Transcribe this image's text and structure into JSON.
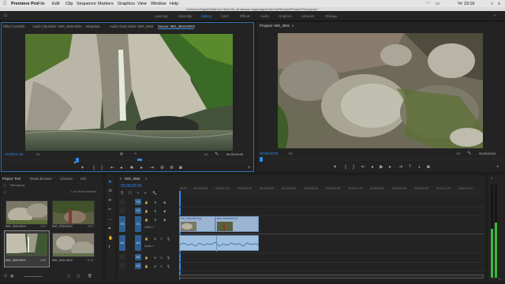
{
  "menubar": {
    "apple": "",
    "items": [
      "Premiere Pro",
      "File",
      "Edit",
      "Clip",
      "Sequence",
      "Markers",
      "Graphics",
      "View",
      "Window",
      "Help"
    ],
    "status": "Чт 19:16"
  },
  "window_title": "/Volumes/Imgal/DataCore 5min/00_Атласные водопады/Camera/Resolve/Project/Test.prproj *",
  "workspaces": {
    "home_icon": "home-icon",
    "items": [
      "Learning",
      "Assembly",
      "Editing",
      "Color",
      "Effects",
      "Audio",
      "Graphics",
      "Libraries",
      "Обзоры"
    ],
    "active": "Editing"
  },
  "source_monitor": {
    "tabs": [
      "Effect Controls",
      "Audio Clip Mixer: IMG_3634.MOV",
      "Metadata",
      "Audio Track Mixer: IMG_3634",
      "Source: IMG_3634.MOV"
    ],
    "active_tab": "Source: IMG_3634.MOV",
    "timecode_left": "00;00;01;28",
    "fit": "Fit",
    "fraction": "1/2",
    "timecode_right": "00;00;04;00"
  },
  "program_monitor": {
    "tab": "Program: IMG_3634",
    "timecode_left": "00;00;00;00",
    "fit": "Fit",
    "fraction": "1/2",
    "timecode_right": "00;00;03;24"
  },
  "project_panel": {
    "tabs": [
      "Project: Test",
      "Media Browser",
      "Libraries",
      "Info"
    ],
    "project_name": "Test.prproj",
    "selection": "1 of 4 items selected",
    "items": [
      {
        "name": "IMG_3634.MOV",
        "duration": "3;24"
      },
      {
        "name": "IMG_3763.MOV",
        "duration": "5;04"
      },
      {
        "name": "IMG_3638.MOV",
        "duration": "4;00"
      },
      {
        "name": "IMG_3641.MOV",
        "duration": "6;10"
      }
    ]
  },
  "timeline": {
    "tab": "IMG_3634",
    "timecode": "00;00;00;00",
    "ruler": [
      "00;00",
      "00;00;00;29",
      "00;00;01;29",
      "00;00;02;29",
      "00;00;03;29",
      "00;00;04;29",
      "00;00;05;29",
      "00;00;06;29",
      "00;00;07;29",
      "00;00;08;29",
      "00;00;09;29",
      "00;00;10;29",
      "00;00;11;29",
      "00;00;12;29"
    ],
    "video_tracks": [
      "V3",
      "V2",
      "V1"
    ],
    "audio_tracks": [
      "A1",
      "A2",
      "A3"
    ],
    "track_names": {
      "v1": "Video 1",
      "a1": "Audio 1"
    },
    "clips": [
      "IMG_3634.MOV [V]",
      "IMG_3763.MOV [V]"
    ]
  },
  "colors": {
    "accent": "#2d8ceb",
    "clip_video": "#9ab4d2",
    "clip_audio": "#9fc0df",
    "audio_level": "#3cb83c"
  }
}
